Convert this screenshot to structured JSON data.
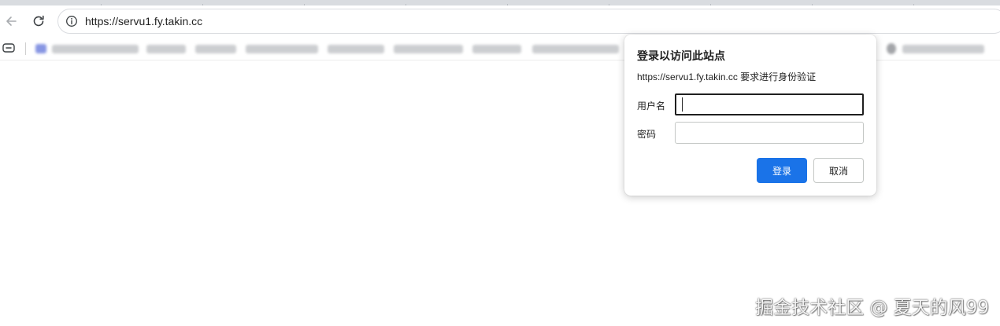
{
  "browser": {
    "url": "https://servu1.fy.takin.cc",
    "icons": {
      "back": "arrow-left-icon",
      "reload": "reload-icon",
      "site_info": "info-icon",
      "apps": "apps-icon"
    }
  },
  "auth_dialog": {
    "title": "登录以访问此站点",
    "subtitle": "https://servu1.fy.takin.cc 要求进行身份验证",
    "username_label": "用户名",
    "username_value": "",
    "password_label": "密码",
    "password_value": "",
    "login_button": "登录",
    "cancel_button": "取消",
    "accent_color": "#1a73e8"
  },
  "watermark": {
    "text": "掘金技术社区 @ 夏天的风99"
  }
}
